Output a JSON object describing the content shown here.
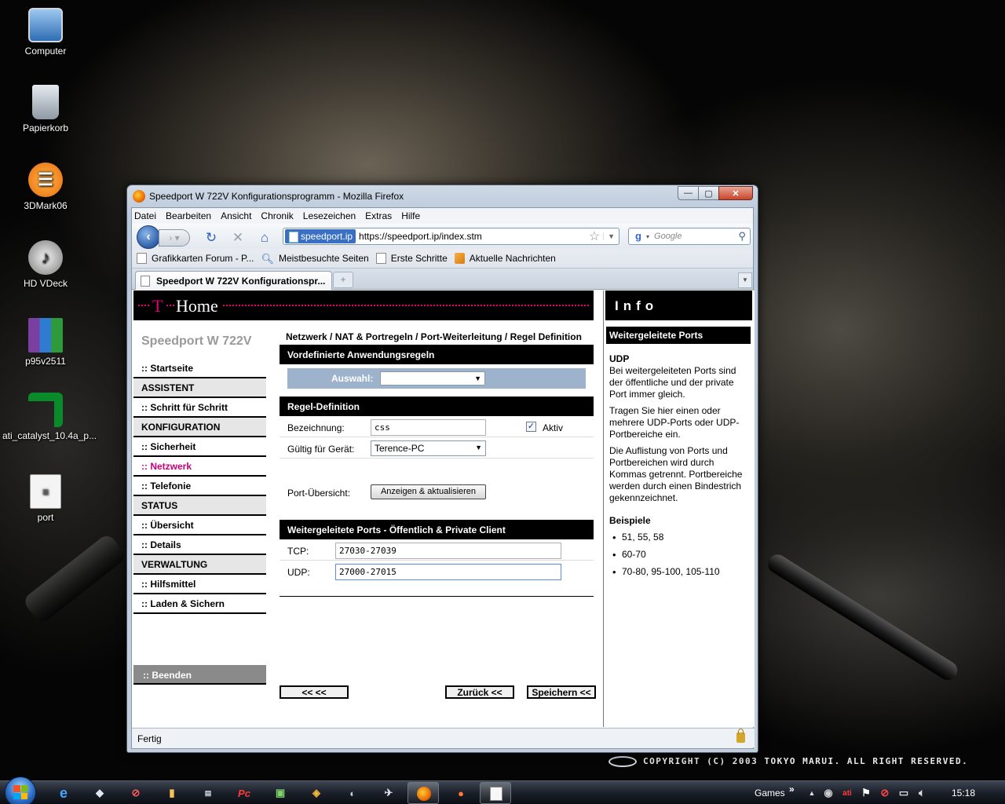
{
  "desktop": {
    "icons": [
      {
        "label": "Computer"
      },
      {
        "label": "Papierkorb"
      },
      {
        "label": "3DMark06"
      },
      {
        "label": "HD VDeck"
      },
      {
        "label": "p95v2511"
      },
      {
        "label": "ati_catalyst_10.4a_p..."
      },
      {
        "label": "port"
      }
    ],
    "copyright": "COPYRIGHT (C) 2003  TOKYO MARUI.  ALL RIGHT RESERVED."
  },
  "window": {
    "title": "Speedport W 722V Konfigurationsprogramm - Mozilla Firefox",
    "controls": {
      "minimize": "—",
      "maximize": "▢",
      "close": "✕"
    }
  },
  "browser": {
    "menu": [
      "Datei",
      "Bearbeiten",
      "Ansicht",
      "Chronik",
      "Lesezeichen",
      "Extras",
      "Hilfe"
    ],
    "identity": "speedport.ip",
    "url": "https://speedport.ip/index.stm",
    "search_placeholder": "Google",
    "bookmarks": [
      "Grafikkarten Forum - P...",
      "Meistbesuchte Seiten",
      "Erste Schritte",
      "Aktuelle Nachrichten"
    ],
    "tab_title": "Speedport W 722V Konfigurationspr...",
    "new_tab": "+",
    "status": "Fertig"
  },
  "router": {
    "brand_t": "T",
    "brand_home": "Home",
    "model": "Speedport W 722V",
    "nav": [
      {
        "label": ":: Startseite",
        "type": "item"
      },
      {
        "label": "ASSISTENT",
        "type": "section"
      },
      {
        "label": ":: Schritt für Schritt",
        "type": "item"
      },
      {
        "label": "KONFIGURATION",
        "type": "section"
      },
      {
        "label": ":: Sicherheit",
        "type": "item"
      },
      {
        "label": ":: Netzwerk",
        "type": "active"
      },
      {
        "label": ":: Telefonie",
        "type": "item"
      },
      {
        "label": "STATUS",
        "type": "section"
      },
      {
        "label": ":: Übersicht",
        "type": "item"
      },
      {
        "label": ":: Details",
        "type": "item"
      },
      {
        "label": "VERWALTUNG",
        "type": "section"
      },
      {
        "label": ":: Hilfsmittel",
        "type": "item"
      },
      {
        "label": ":: Laden & Sichern",
        "type": "item"
      }
    ],
    "nav_exit": ":: Beenden",
    "breadcrumb": "Netzwerk / NAT & Portregeln / Port-Weiterleitung / Regel Definition",
    "predefined": {
      "heading": "Vordefinierte Anwendungsregeln",
      "label": "Auswahl:",
      "value": ""
    },
    "rule": {
      "heading": "Regel-Definition",
      "name_label": "Bezeichnung:",
      "name_value": "css",
      "active_label": "Aktiv",
      "active_checked": true,
      "device_label": "Gültig für Gerät:",
      "device_value": "Terence-PC",
      "overview_label": "Port-Übersicht:",
      "overview_button": "Anzeigen & aktualisieren"
    },
    "ports": {
      "heading": "Weitergeleitete Ports - Öffentlich & Private Client",
      "tcp_label": "TCP:",
      "tcp_value": "27030-27039",
      "udp_label": "UDP:",
      "udp_value": "27000-27015"
    },
    "buttons": {
      "back_all": "<<  <<",
      "back": "Zurück <<",
      "save": "Speichern <<"
    },
    "info": {
      "header": "Info",
      "box_title": "Weitergeleitete Ports",
      "udp_title": "UDP",
      "p1": "Bei weitergeleiteten Ports sind der öffentliche und der private Port immer gleich.",
      "p2": "Tragen Sie hier einen oder mehrere UDP-Ports oder UDP-Portbereiche ein.",
      "p3": "Die Auflistung von Ports und Portbereichen wird durch Kommas getrennt. Portbereiche werden durch einen Bindestrich gekennzeichnet.",
      "examples_title": "Beispiele",
      "examples": [
        "51, 55, 58",
        "60-70",
        "70-80, 95-100, 105-110"
      ]
    }
  },
  "taskbar": {
    "tray_label": "Games",
    "tray_chevron": "»",
    "clock": "15:18"
  }
}
